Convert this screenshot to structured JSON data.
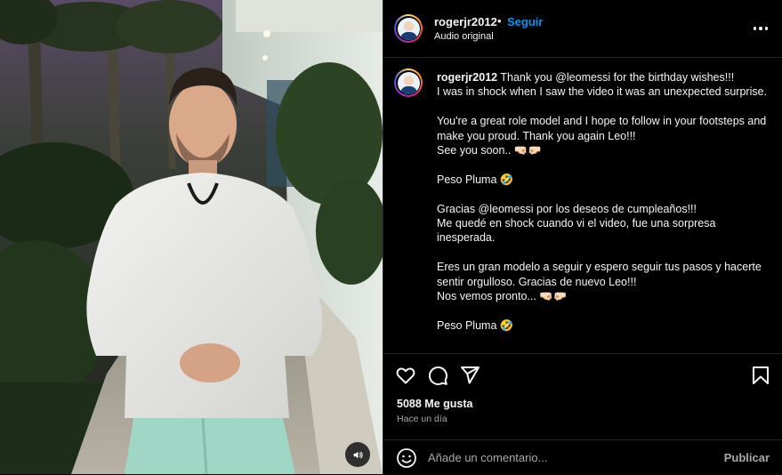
{
  "header": {
    "username": "rogerjr2012",
    "separator": "•",
    "follow_label": "Seguir",
    "audio": "Audio original"
  },
  "caption": {
    "username": "rogerjr2012",
    "text": "Thank you @leomessi for the birthday wishes!!!\nI was in shock when I saw the video it was an unexpected surprise.\n\nYou're a great role model and I hope to follow in your footsteps and make you proud. Thank you again Leo!!!\nSee you soon.. 🤜🏻🤛🏻\n\nPeso Pluma 🤣\n\nGracias @leomessi por los deseos de cumpleaños!!!\nMe quedé en shock cuando vi el video, fue una sorpresa inesperada.\n\nEres un gran modelo a seguir y espero seguir tus pasos y hacerte sentir orgulloso. Gracias de nuevo Leo!!!\nNos vemos pronto... 🤜🏻🤛🏻\n\nPeso Pluma 🤣"
  },
  "stats": {
    "likes": "5088 Me gusta",
    "time": "Hace un día"
  },
  "comment": {
    "placeholder": "Añade un comentario...",
    "publish_label": "Publicar"
  },
  "icons": {
    "like": "heart-icon",
    "comment": "comment-icon",
    "share": "send-icon",
    "save": "bookmark-icon",
    "more": "more-horizontal-icon",
    "emoji": "emoji-icon",
    "audio": "volume-icon"
  },
  "colors": {
    "background": "#000000",
    "accent": "#0095f6",
    "text": "#f5f5f5",
    "muted": "#a8a8a8",
    "divider": "#262626"
  }
}
